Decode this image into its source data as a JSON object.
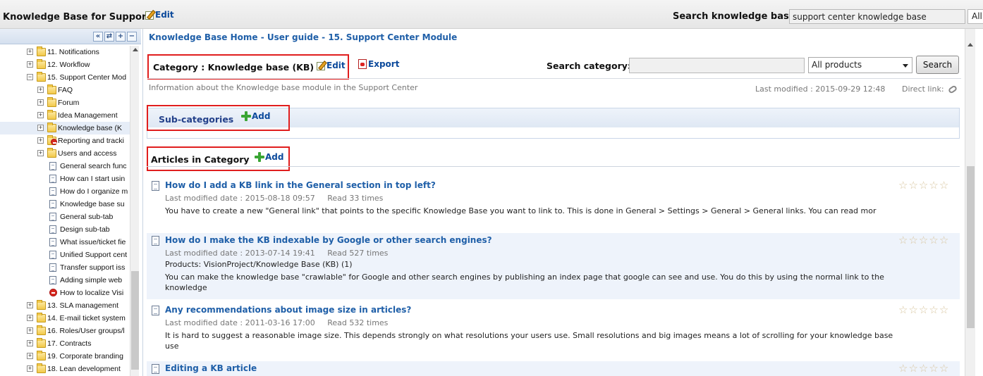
{
  "header": {
    "app_title": "Knowledge Base for Support",
    "edit_label": "Edit",
    "search_label": "Search knowledge base:",
    "search_value": "support center knowledge base",
    "search_scope": "All"
  },
  "tree_toolbar": {
    "buttons": [
      "«",
      "⇄",
      "+",
      "−"
    ]
  },
  "tree": [
    {
      "label": "11. Notifications",
      "type": "folder",
      "level": 0,
      "expander": "+"
    },
    {
      "label": "12. Workflow",
      "type": "folder",
      "level": 0,
      "expander": "+"
    },
    {
      "label": "15. Support Center Mod",
      "type": "folder",
      "level": 0,
      "expander": "−"
    },
    {
      "label": "FAQ",
      "type": "folder",
      "level": 1,
      "expander": "+"
    },
    {
      "label": "Forum",
      "type": "folder",
      "level": 1,
      "expander": "+"
    },
    {
      "label": "Idea Management",
      "type": "folder",
      "level": 1,
      "expander": "+"
    },
    {
      "label": "Knowledge base (K",
      "type": "folder",
      "level": 1,
      "expander": "+",
      "selected": true
    },
    {
      "label": "Reporting and tracki",
      "type": "nofolder",
      "level": 1,
      "expander": "+"
    },
    {
      "label": "Users and access",
      "type": "folder",
      "level": 1,
      "expander": "+"
    },
    {
      "label": "General search func",
      "type": "doc",
      "level": 1
    },
    {
      "label": "How can I start usin",
      "type": "doc",
      "level": 1
    },
    {
      "label": "How do I organize m",
      "type": "doc",
      "level": 1
    },
    {
      "label": "Knowledge base su",
      "type": "doc",
      "level": 1
    },
    {
      "label": "General sub-tab",
      "type": "doc",
      "level": 1
    },
    {
      "label": "Design sub-tab",
      "type": "doc",
      "level": 1
    },
    {
      "label": "What issue/ticket fie",
      "type": "doc",
      "level": 1
    },
    {
      "label": "Unified Support cent",
      "type": "doc",
      "level": 1
    },
    {
      "label": "Transfer support iss",
      "type": "doc",
      "level": 1
    },
    {
      "label": "Adding simple web",
      "type": "doc",
      "level": 1
    },
    {
      "label": "How to localize Visi",
      "type": "nodoc",
      "level": 1
    },
    {
      "label": "13. SLA management",
      "type": "folder",
      "level": 0,
      "expander": "+"
    },
    {
      "label": "14. E-mail ticket system",
      "type": "folder",
      "level": 0,
      "expander": "+"
    },
    {
      "label": "16. Roles/User groups/l",
      "type": "folder",
      "level": 0,
      "expander": "+"
    },
    {
      "label": "17. Contracts",
      "type": "folder",
      "level": 0,
      "expander": "+"
    },
    {
      "label": "19. Corporate branding",
      "type": "folder",
      "level": 0,
      "expander": "+"
    },
    {
      "label": "18. Lean development",
      "type": "folder",
      "level": 0,
      "expander": "+"
    }
  ],
  "main": {
    "breadcrumb": "Knowledge Base Home - User guide - 15. Support Center Module",
    "category_title": "Category : Knowledge base (KB)",
    "edit_label": "Edit",
    "export_label": "Export",
    "search_category_label": "Search category:",
    "search_category_value": "",
    "product_select": "All products",
    "search_button": "Search",
    "category_description": "Information about the Knowledge base module in the Support Center",
    "last_modified": "Last modified : 2015-09-29 12:48",
    "direct_link_label": "Direct link:",
    "subcategories_label": "Sub-categories",
    "add_label": "Add",
    "articles_label": "Articles in Category"
  },
  "articles": [
    {
      "title": "How do I add a KB link in the General section in top left?",
      "modified": "Last modified date : 2015-08-18 09:57",
      "read": "Read 33 times",
      "products": "",
      "body": "You have to create a new \"General link\" that points to the specific Knowledge Base you want to link to. This is done in General > Settings > General > General links. You can read mor",
      "rating": 0
    },
    {
      "title": "How do I make the KB indexable by Google or other search engines?",
      "modified": "Last modified date : 2013-07-14 19:41",
      "read": "Read 527 times",
      "products": "Products: VisionProject/Knowledge Base (KB) (1)",
      "body": "You can make the knowledge base \"crawlable\" for Google and other search engines by publishing an index page that google can see and use. You do this by using the normal link to the knowledge",
      "rating": 0
    },
    {
      "title": "Any recommendations about image size in articles?",
      "modified": "Last modified date : 2011-03-16 17:00",
      "read": "Read 532 times",
      "products": "",
      "body": "It is hard to suggest a reasonable image size. This depends strongly on what resolutions your users use. Small resolutions and big images means a lot of scrolling for your knowledge base use",
      "rating": 0
    },
    {
      "title": "Editing a KB article",
      "modified": "",
      "read": "",
      "products": "",
      "body": "",
      "rating": 0
    }
  ],
  "colors": {
    "link": "#1f5fa8",
    "highlight_box": "#e01e1e",
    "alt_row": "#eef3fb"
  }
}
